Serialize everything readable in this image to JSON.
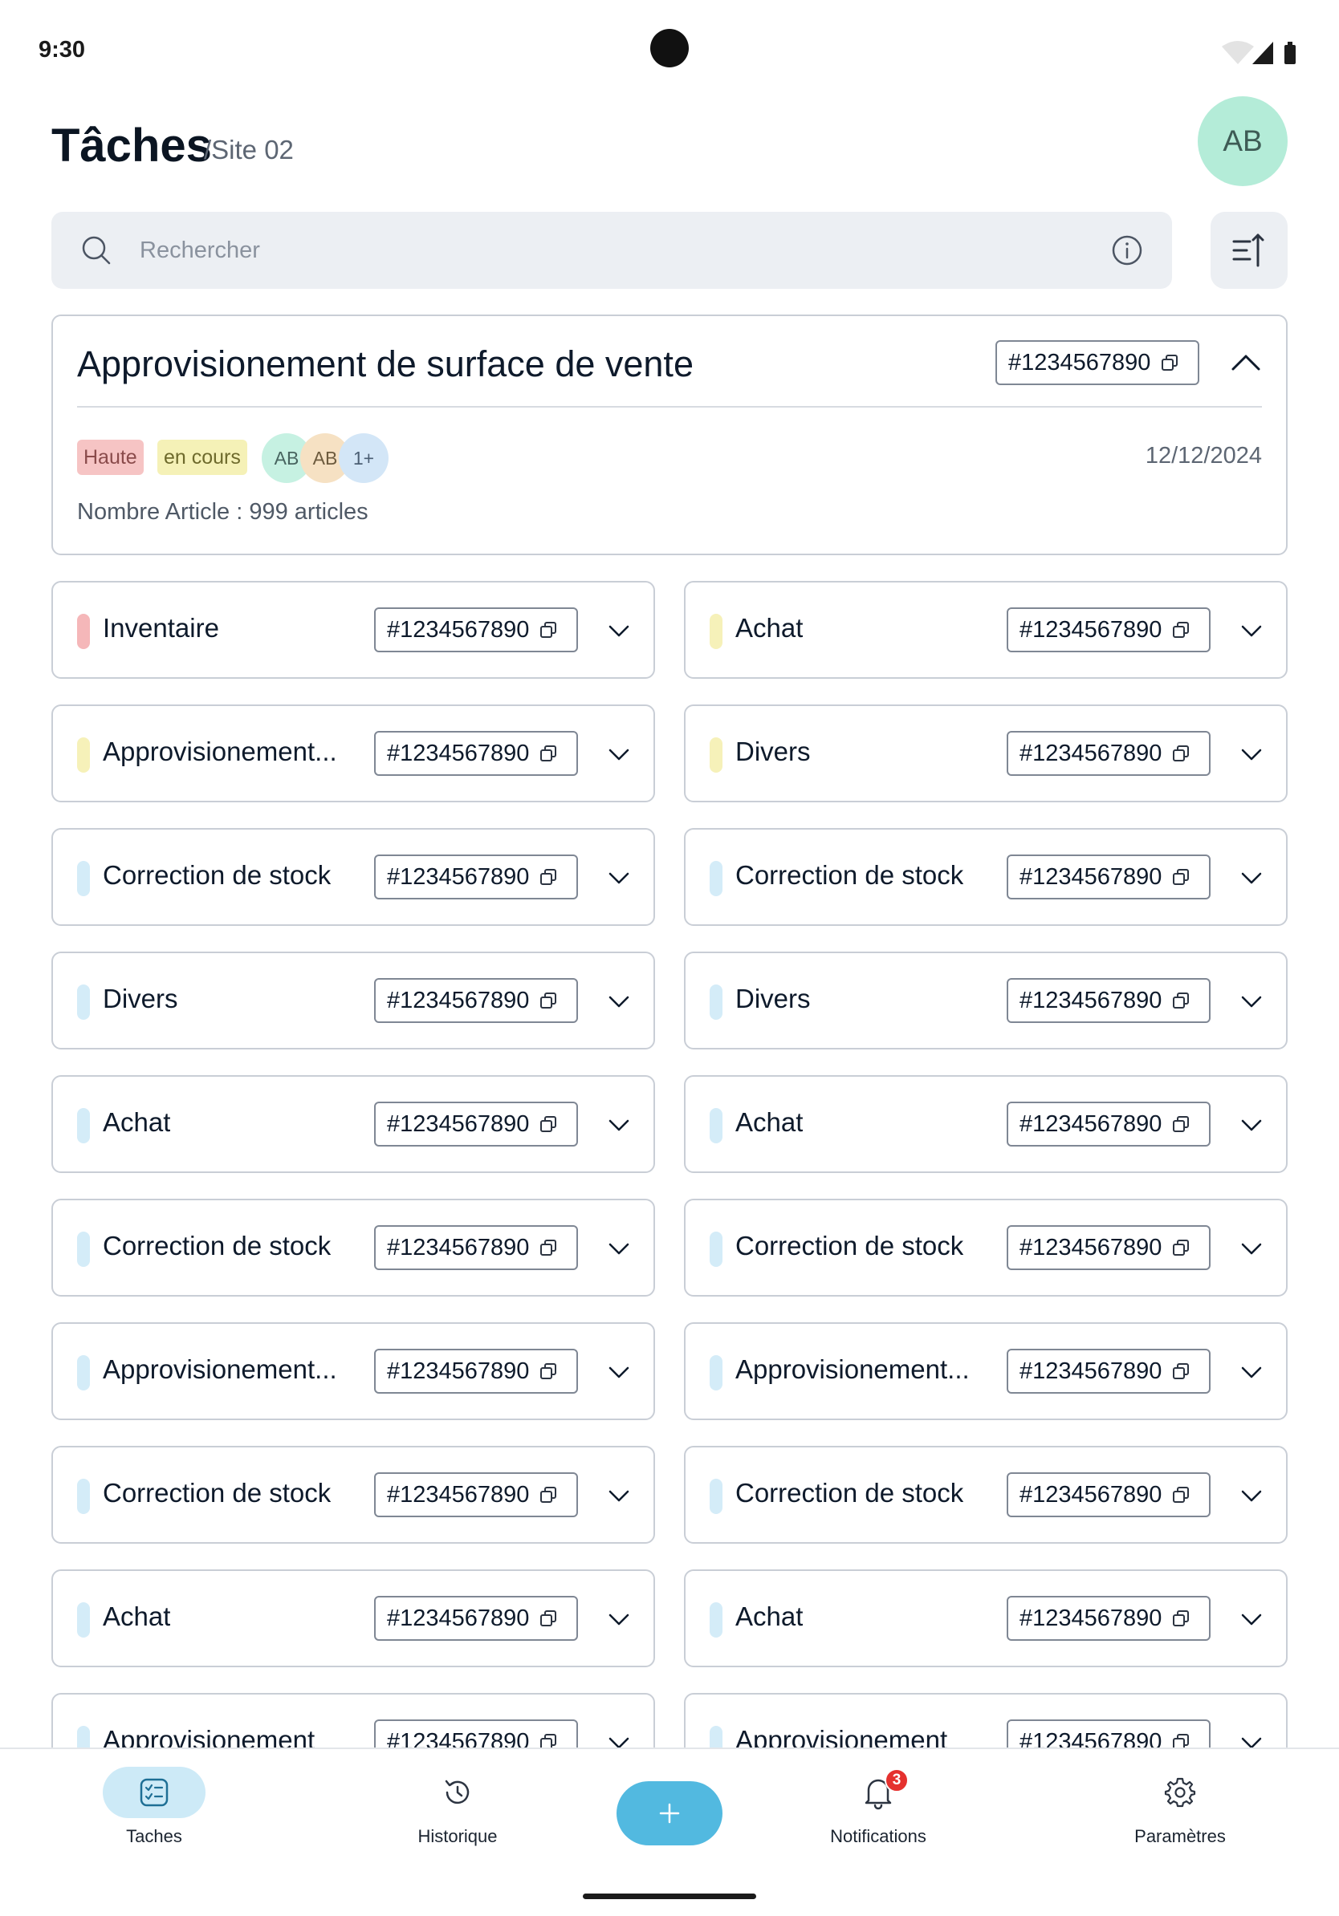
{
  "status_bar": {
    "time": "9:30"
  },
  "header": {
    "title": "Tâches",
    "subtitle": "/Site 02",
    "avatar_initials": "AB"
  },
  "search": {
    "placeholder": "Rechercher",
    "value": ""
  },
  "main_card": {
    "title": "Approvisionement de surface de vente",
    "reference": "#1234567890",
    "priority": "Haute",
    "status": "en cours",
    "assignees": [
      "AB",
      "AB",
      "1+"
    ],
    "date": "12/12/2024",
    "count_text": "Nombre Article : 999 articles"
  },
  "tasks": [
    {
      "label": "Inventaire",
      "reference": "#1234567890",
      "color": "#f5b7b9"
    },
    {
      "label": "Achat",
      "reference": "#1234567890",
      "color": "#f6f1b9"
    },
    {
      "label": "Approvisionement...",
      "reference": "#1234567890",
      "color": "#f6f1b9"
    },
    {
      "label": "Divers",
      "reference": "#1234567890",
      "color": "#f6f1b9"
    },
    {
      "label": "Correction de stock",
      "reference": "#1234567890",
      "color": "#d4ecf8"
    },
    {
      "label": "Correction de stock",
      "reference": "#1234567890",
      "color": "#d4ecf8"
    },
    {
      "label": "Divers",
      "reference": "#1234567890",
      "color": "#d4ecf8"
    },
    {
      "label": "Divers",
      "reference": "#1234567890",
      "color": "#d4ecf8"
    },
    {
      "label": "Achat",
      "reference": "#1234567890",
      "color": "#d4ecf8"
    },
    {
      "label": "Achat",
      "reference": "#1234567890",
      "color": "#d4ecf8"
    },
    {
      "label": "Correction de stock",
      "reference": "#1234567890",
      "color": "#d4ecf8"
    },
    {
      "label": "Correction de stock",
      "reference": "#1234567890",
      "color": "#d4ecf8"
    },
    {
      "label": "Approvisionement...",
      "reference": "#1234567890",
      "color": "#d4ecf8"
    },
    {
      "label": "Approvisionement...",
      "reference": "#1234567890",
      "color": "#d4ecf8"
    },
    {
      "label": "Correction de stock",
      "reference": "#1234567890",
      "color": "#d4ecf8"
    },
    {
      "label": "Correction de stock",
      "reference": "#1234567890",
      "color": "#d4ecf8"
    },
    {
      "label": "Achat",
      "reference": "#1234567890",
      "color": "#d4ecf8"
    },
    {
      "label": "Achat",
      "reference": "#1234567890",
      "color": "#d4ecf8"
    },
    {
      "label": "Approvisionement",
      "reference": "#1234567890",
      "color": "#d4ecf8"
    },
    {
      "label": "Approvisionement",
      "reference": "#1234567890",
      "color": "#d4ecf8"
    }
  ],
  "nav": {
    "tasks": "Taches",
    "history": "Historique",
    "notifications": "Notifications",
    "notifications_count": "3",
    "settings": "Paramètres"
  },
  "colors": {
    "accent": "#52b9e0",
    "active_nav_bg": "#cdeaf7",
    "badge_red": "#e5312e"
  }
}
